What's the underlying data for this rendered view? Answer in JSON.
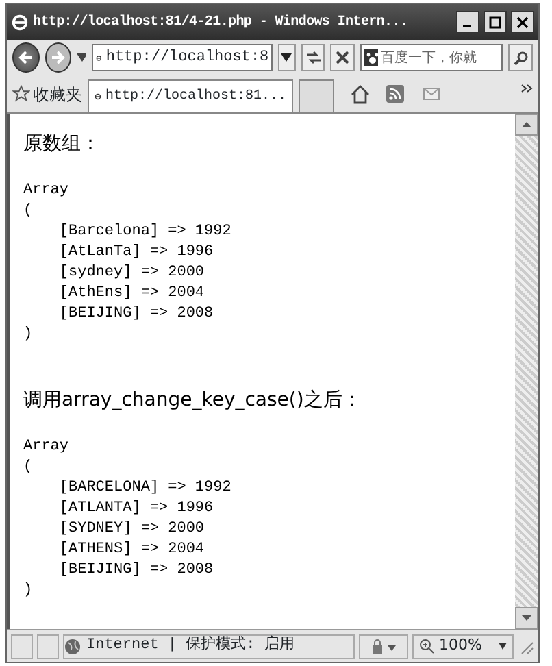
{
  "window": {
    "title": "http://localhost:81/4-21.php - Windows Intern..."
  },
  "address_bar": {
    "value": "http://localhost:8"
  },
  "search": {
    "placeholder": "百度一下，你就"
  },
  "favorites": {
    "label": "收藏夹"
  },
  "tabs": [
    {
      "label": "http://localhost:81...",
      "selected": true
    }
  ],
  "sections": [
    {
      "heading": "原数组：",
      "lines": [
        "Array",
        "(",
        "    [Barcelona] => 1992",
        "    [AtLanTa] => 1996",
        "    [sydney] => 2000",
        "    [AthEns] => 2004",
        "    [BEIJING] => 2008",
        ")"
      ]
    },
    {
      "heading": "调用array_change_key_case()之后：",
      "lines": [
        "Array",
        "(",
        "    [BARCELONA] => 1992",
        "    [ATLANTA] => 1996",
        "    [SYDNEY] => 2000",
        "    [ATHENS] => 2004",
        "    [BEIJING] => 2008",
        ")"
      ]
    }
  ],
  "status_bar": {
    "zone": "Internet | 保护模式: 启用",
    "zoom": "100%"
  }
}
